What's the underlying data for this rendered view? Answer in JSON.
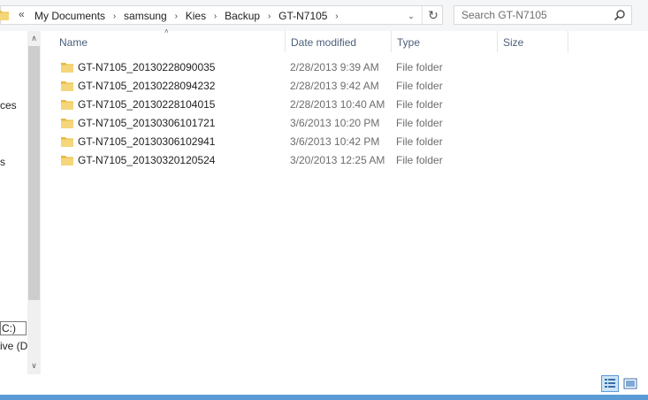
{
  "address_bar": {
    "overflow": "«",
    "breadcrumb": [
      "My Documents",
      "samsung",
      "Kies",
      "Backup",
      "GT-N7105"
    ],
    "separator": "›",
    "dropdown_glyph": "⌄",
    "refresh_glyph": "↻"
  },
  "search": {
    "placeholder": "Search GT-N7105",
    "icon": "search-icon"
  },
  "nav_pane": {
    "fragments": [
      "ces",
      "s",
      "C:)",
      "ive (D"
    ],
    "scroll_up": "∧",
    "scroll_down": "∨"
  },
  "columns": {
    "name": "Name",
    "date_modified": "Date modified",
    "type": "Type",
    "size": "Size",
    "sort_glyph": "˄"
  },
  "files": [
    {
      "name": "GT-N7105_20130228090035",
      "date": "2/28/2013 9:39 AM",
      "type": "File folder",
      "size": ""
    },
    {
      "name": "GT-N7105_20130228094232",
      "date": "2/28/2013 9:42 AM",
      "type": "File folder",
      "size": ""
    },
    {
      "name": "GT-N7105_20130228104015",
      "date": "2/28/2013 10:40 AM",
      "type": "File folder",
      "size": ""
    },
    {
      "name": "GT-N7105_20130306101721",
      "date": "3/6/2013 10:20 PM",
      "type": "File folder",
      "size": ""
    },
    {
      "name": "GT-N7105_20130306102941",
      "date": "3/6/2013 10:42 PM",
      "type": "File folder",
      "size": ""
    },
    {
      "name": "GT-N7105_20130320120524",
      "date": "3/20/2013 12:25 AM",
      "type": "File folder",
      "size": ""
    }
  ],
  "status_bar": {
    "views": [
      "details-view-icon",
      "large-icons-view-icon"
    ]
  },
  "colors": {
    "folder": "#f1c75a",
    "header_text": "#4c607a",
    "secondary_text": "#6d6d6d",
    "accent_border": "#5b9bd5"
  }
}
